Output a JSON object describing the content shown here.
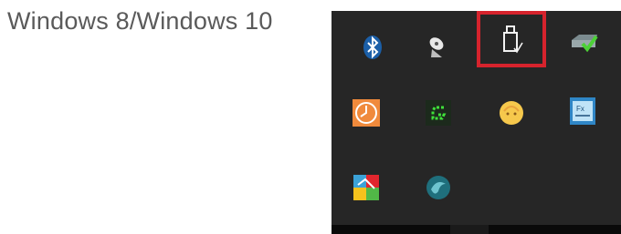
{
  "caption": "Windows 8/Windows 10",
  "tray": {
    "icons": [
      {
        "name": "bluetooth-icon"
      },
      {
        "name": "network-satellite-icon"
      },
      {
        "name": "usb-drive-icon",
        "highlighted": true
      },
      {
        "name": "drive-check-icon"
      },
      {
        "name": "clock-app-icon"
      },
      {
        "name": "green-g-app-icon"
      },
      {
        "name": "yellow-face-icon"
      },
      {
        "name": "window-fx-icon"
      },
      {
        "name": "colorful-tiles-icon"
      },
      {
        "name": "teal-swirl-icon"
      }
    ],
    "highlight_color": "#d6232d",
    "background_color": "#262626"
  }
}
